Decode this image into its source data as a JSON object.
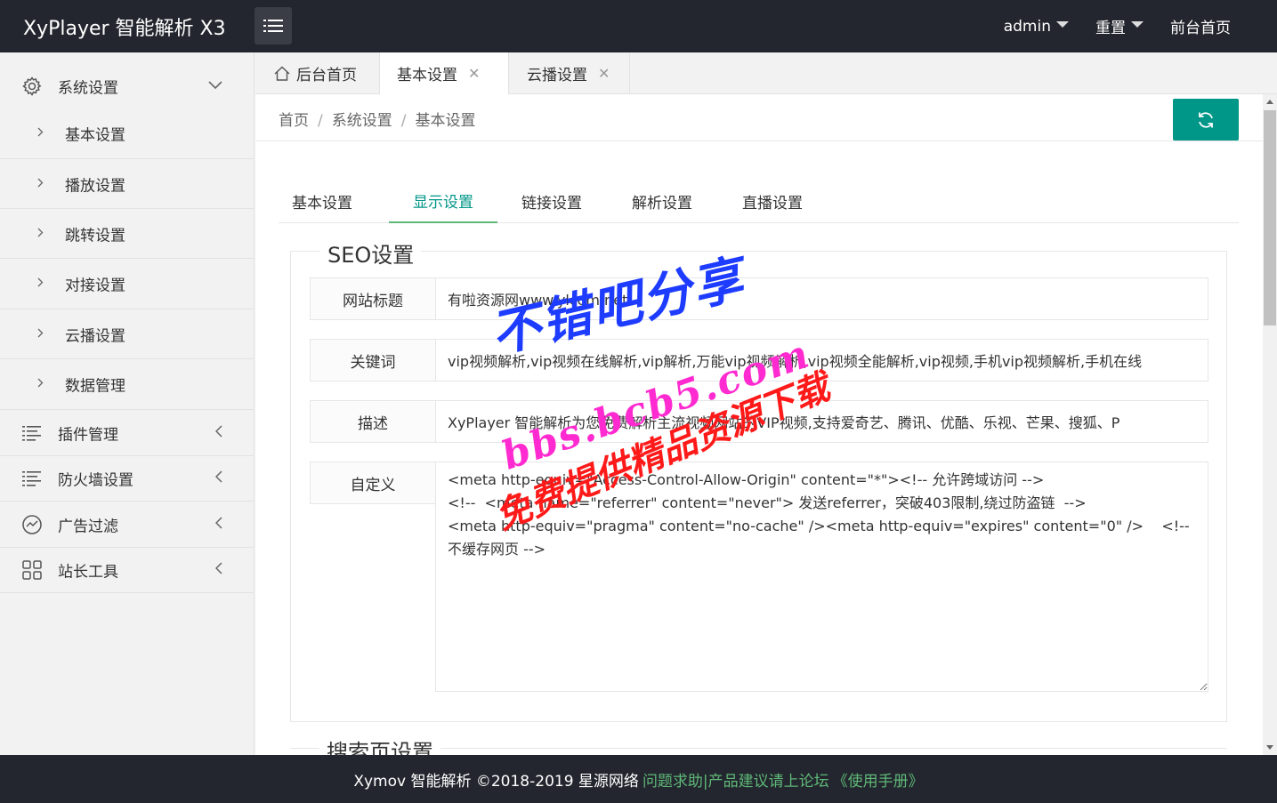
{
  "app": {
    "title": "XyPlayer 智能解析 X3"
  },
  "header": {
    "nav": [
      {
        "label": "admin",
        "caret": true
      },
      {
        "label": "重置",
        "caret": true
      },
      {
        "label": "前台首页",
        "caret": false
      }
    ]
  },
  "sidebar": {
    "groups": [
      {
        "label": "系统设置",
        "icon": "gear-icon",
        "expanded": true,
        "items": [
          "基本设置",
          "播放设置",
          "跳转设置",
          "对接设置",
          "云播设置",
          "数据管理"
        ]
      },
      {
        "label": "插件管理",
        "icon": "list-icon",
        "expanded": false
      },
      {
        "label": "防火墙设置",
        "icon": "list-icon",
        "expanded": false
      },
      {
        "label": "广告过滤",
        "icon": "chart-circle-icon",
        "expanded": false
      },
      {
        "label": "站长工具",
        "icon": "grid-icon",
        "expanded": false
      }
    ]
  },
  "page_tabs": [
    {
      "label": "后台首页",
      "icon": "home-icon",
      "closable": false
    },
    {
      "label": "基本设置",
      "closable": true,
      "active": true
    },
    {
      "label": "云播设置",
      "closable": true
    }
  ],
  "breadcrumb": [
    "首页",
    "系统设置",
    "基本设置"
  ],
  "sub_tabs": [
    {
      "label": "基本设置"
    },
    {
      "label": "显示设置",
      "active": true
    },
    {
      "label": "链接设置"
    },
    {
      "label": "解析设置"
    },
    {
      "label": "直播设置"
    }
  ],
  "seo": {
    "legend": "SEO设置",
    "fields": [
      {
        "label": "网站标题",
        "value": "有啦资源网www.ylcom.net"
      },
      {
        "label": "关键词",
        "value": "vip视频解析,vip视频在线解析,vip解析,万能vip视频解析,vip视频全能解析,vip视频,手机vip视频解析,手机在线"
      },
      {
        "label": "描述",
        "value": "XyPlayer 智能解析为您免费解析主流视频网站的VIP视频,支持爱奇艺、腾讯、优酷、乐视、芒果、搜狐、P"
      },
      {
        "label": "自定义",
        "value": "<meta http-equiv=\"Access-Control-Allow-Origin\" content=\"*\"><!-- 允许跨域访问 -->\n<!--  <meta name=\"referrer\" content=\"never\"> 发送referrer，突破403限制,绕过防盗链  -->\n<meta http-equiv=\"pragma\" content=\"no-cache\" /><meta http-equiv=\"expires\" content=\"0\" />    <!-- 不缓存网页 -->"
      }
    ]
  },
  "search_section": {
    "legend": "搜索页设置"
  },
  "footer": {
    "text": "Xymov 智能解析 ©2018-2019 星源网络",
    "link1": "问题求助|产品建议请上论坛",
    "link2": "《使用手册》"
  },
  "watermark": {
    "line1": "不错吧分享",
    "line2": "bbs.bcb5.com",
    "line3": "免费提供精品资源下载"
  },
  "colors": {
    "header_bg": "#23262e",
    "accent": "#009688",
    "active_tab": "#5fb878"
  }
}
